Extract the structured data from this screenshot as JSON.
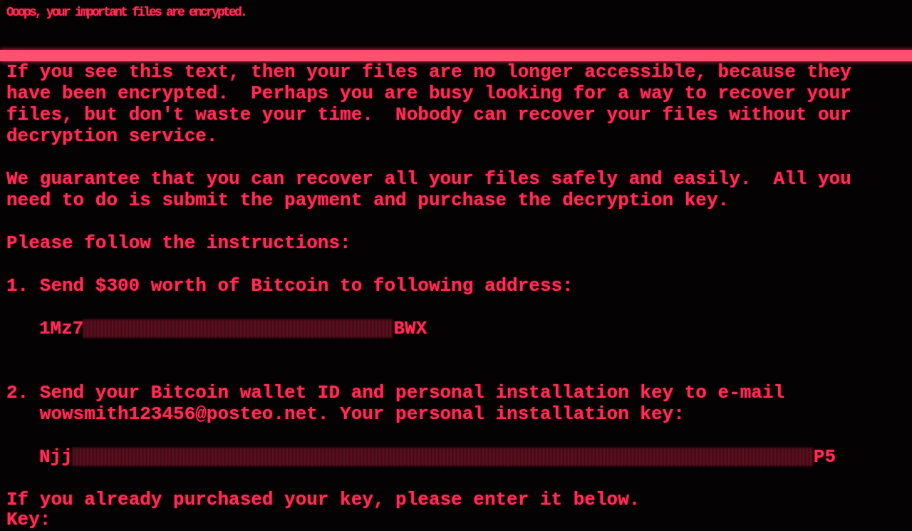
{
  "title": "Ooops, your important files are encrypted.",
  "paragraphs": [
    "If you see this text, then your files are no longer accessible, because they have been encrypted.  Perhaps you are busy looking for a way to recover your files, but don't waste your time.  Nobody can recover your files without our decryption service.",
    "We guarantee that you can recover all your files safely and easily.  All you need to do is submit the payment and purchase the decryption key.",
    "Please follow the instructions:"
  ],
  "steps": [
    {
      "number": "1.",
      "text": "Send $300 worth of Bitcoin to following address:",
      "code": {
        "start": "1Mz7",
        "end": "BWX"
      }
    },
    {
      "number": "2.",
      "text": "Send your Bitcoin wallet ID and personal installation key to e-mail wowsmith123456@posteo.net. Your personal installation key:",
      "code": {
        "start": "Njj",
        "end": "P5"
      }
    }
  ],
  "prompt": "If you already purchased your key, please enter it below.",
  "key_label": "Key:"
}
